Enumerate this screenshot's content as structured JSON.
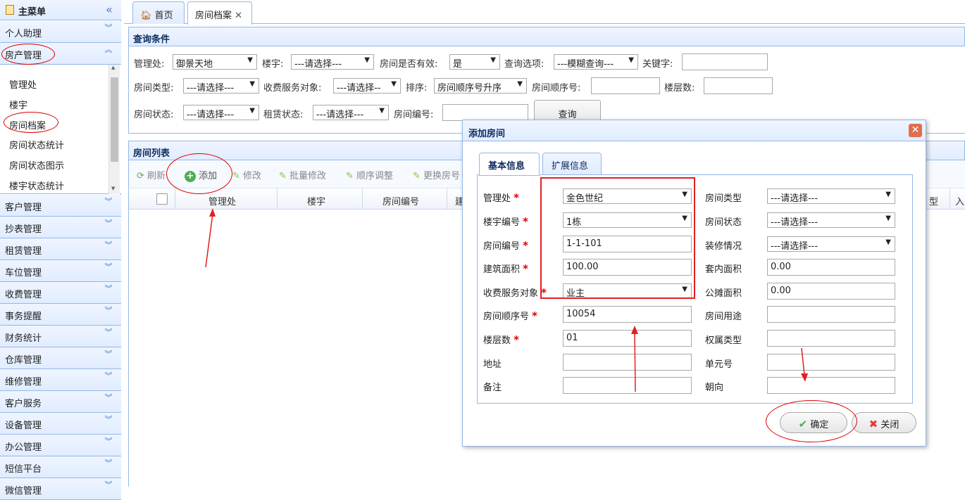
{
  "sidebar": {
    "title": "主菜单",
    "groups_top": [
      {
        "label": "个人助理"
      },
      {
        "label": "房产管理"
      }
    ],
    "sub_items": [
      "管理处",
      "楼宇",
      "房间档案",
      "房间状态统计",
      "房间状态图示",
      "楼宇状态统计"
    ],
    "groups_bottom": [
      "客户管理",
      "抄表管理",
      "租赁管理",
      "车位管理",
      "收费管理",
      "事务提醒",
      "财务统计",
      "仓库管理",
      "维修管理",
      "客户服务",
      "设备管理",
      "办公管理",
      "短信平台",
      "微信管理"
    ]
  },
  "tabs": [
    {
      "label": "首页"
    },
    {
      "label": "房间档案"
    }
  ],
  "query": {
    "title": "查询条件",
    "row1": {
      "mgmt_label": "管理处:",
      "mgmt_value": "御景天地",
      "building_label": "楼宇:",
      "building_value": "---请选择---",
      "valid_label": "房间是否有效:",
      "valid_value": "是",
      "option_label": "查询选项:",
      "option_value": "---模糊查询---",
      "keyword_label": "关键字:"
    },
    "row2": {
      "type_label": "房间类型:",
      "type_value": "---请选择---",
      "service_label": "收费服务对象:",
      "service_value": "---请选择--",
      "sort_label": "排序:",
      "sort_value": "房间顺序号升序",
      "seq_label": "房间顺序号:",
      "floors_label": "楼层数:"
    },
    "row3": {
      "status_label": "房间状态:",
      "status_value": "---请选择---",
      "lease_label": "租赁状态:",
      "lease_value": "---请选择---",
      "roomno_label": "房间编号:"
    },
    "search_button": "查询"
  },
  "list": {
    "title": "房间列表",
    "toolbar": [
      "刷新",
      "添加",
      "修改",
      "批量修改",
      "顺序调整",
      "更换房号"
    ],
    "columns": [
      "管理处",
      "楼宇",
      "房间编号",
      "建",
      "型",
      "入"
    ]
  },
  "dialog": {
    "title": "添加房间",
    "tabs": [
      "基本信息",
      "扩展信息"
    ],
    "left_fields": [
      {
        "label": "管理处",
        "required": true,
        "kind": "select",
        "value": "金色世纪"
      },
      {
        "label": "楼宇编号",
        "required": true,
        "kind": "select",
        "value": "1栋"
      },
      {
        "label": "房间编号",
        "required": true,
        "kind": "input",
        "value": "1-1-101"
      },
      {
        "label": "建筑面积",
        "required": true,
        "kind": "input",
        "value": "100.00"
      },
      {
        "label": "收费服务对象",
        "required": true,
        "kind": "select",
        "value": "业主"
      },
      {
        "label": "房间顺序号",
        "required": true,
        "kind": "input",
        "value": "10054"
      },
      {
        "label": "楼层数",
        "required": true,
        "kind": "input",
        "value": "01"
      },
      {
        "label": "地址",
        "required": false,
        "kind": "input",
        "value": ""
      },
      {
        "label": "备注",
        "required": false,
        "kind": "input",
        "value": ""
      }
    ],
    "right_fields": [
      {
        "label": "房间类型",
        "kind": "select",
        "value": "---请选择---"
      },
      {
        "label": "房间状态",
        "kind": "select",
        "value": "---请选择---"
      },
      {
        "label": "装修情况",
        "kind": "select",
        "value": "---请选择---"
      },
      {
        "label": "套内面积",
        "kind": "input",
        "value": "0.00"
      },
      {
        "label": "公摊面积",
        "kind": "input",
        "value": "0.00"
      },
      {
        "label": "房间用途",
        "kind": "input",
        "value": ""
      },
      {
        "label": "权属类型",
        "kind": "input",
        "value": ""
      },
      {
        "label": "单元号",
        "kind": "input",
        "value": ""
      },
      {
        "label": "朝向",
        "kind": "input",
        "value": ""
      }
    ],
    "ok_button": "确定",
    "close_button": "关闭"
  },
  "colors": {
    "border": "#95b8e7",
    "header_bg": "#e0ecff",
    "annotation": "#e02020",
    "required": "#dd0000"
  },
  "icons": [
    "home-icon",
    "close-icon",
    "refresh-icon",
    "add-icon",
    "pencil-icon",
    "check-icon",
    "cross-icon",
    "chevron-double-down-icon",
    "chevron-double-up-icon",
    "chevron-double-left-icon"
  ]
}
